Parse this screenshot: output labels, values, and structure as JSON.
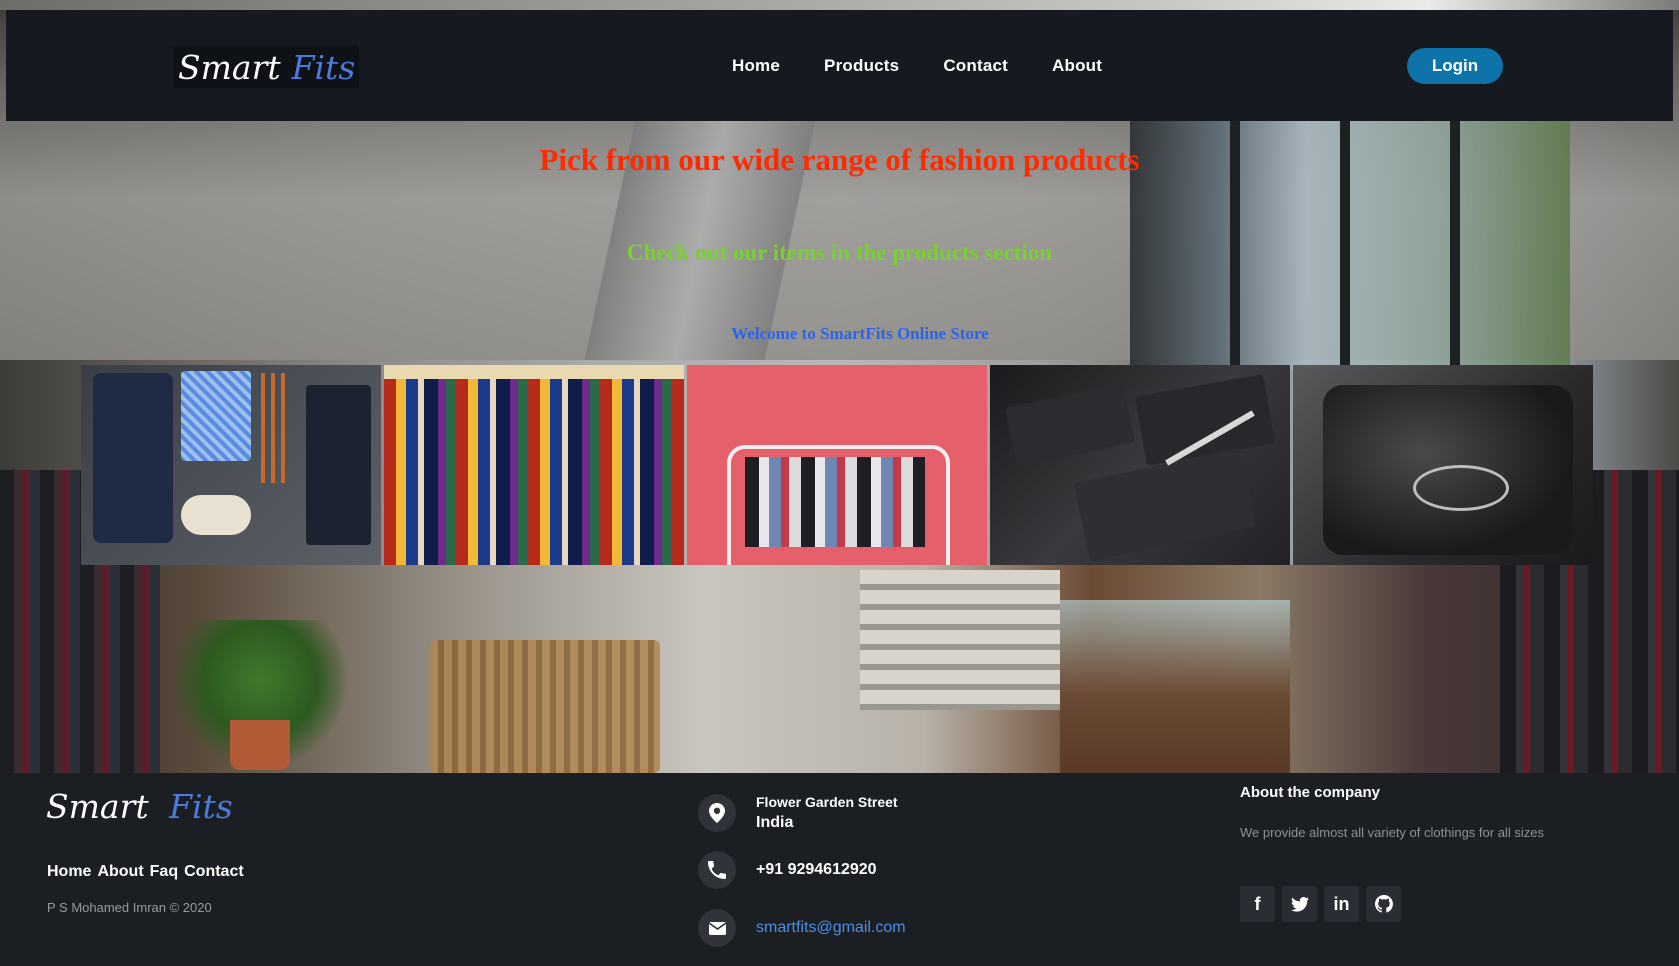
{
  "brand": {
    "word1": "Smart",
    "word2": "Fits"
  },
  "nav": {
    "links": [
      "Home",
      "Products",
      "Contact",
      "About"
    ],
    "login_label": "Login"
  },
  "hero": {
    "title": "Pick from our wide range of fashion products",
    "subtitle": "Check out our items in the products section",
    "welcome": "Welcome to SmartFits Online Store"
  },
  "products": {
    "tiles": [
      "suit-flatlay-image",
      "clothing-rack-colorful-image",
      "clothing-rack-pink-image",
      "black-tshirts-image",
      "dark-jacket-image"
    ]
  },
  "footer": {
    "brand": {
      "word1": "Smart",
      "word2": "Fits"
    },
    "links": [
      "Home",
      "About",
      "Faq",
      "Contact"
    ],
    "copyright": "P S Mohamed Imran © 2020",
    "address_line1": "Flower Garden Street",
    "address_line2": "India",
    "phone": "+91 9294612920",
    "email": "smartfits@gmail.com",
    "about_title": "About the company",
    "about_text": "We provide almost all variety of clothings for all sizes",
    "socials": [
      "facebook-icon",
      "twitter-icon",
      "linkedin-icon",
      "github-icon"
    ]
  },
  "colors": {
    "nav_bg": "#161a20",
    "login_bg": "#0d73a8",
    "brand_accent": "#4b7bdc",
    "hero_title": "#ff2a00",
    "hero_subtitle": "#7ad032",
    "hero_welcome": "#2f63e6",
    "footer_bg": "#1b1f24"
  }
}
